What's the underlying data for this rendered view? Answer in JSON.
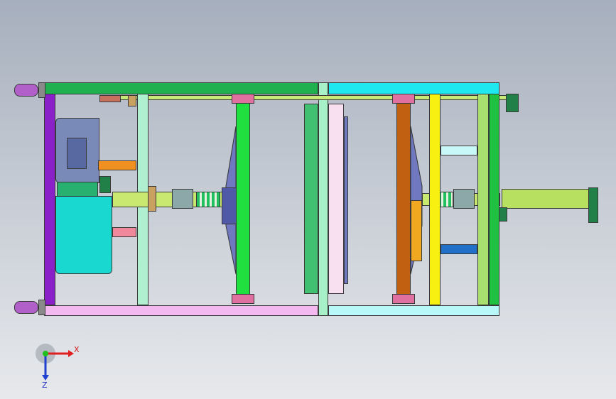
{
  "viewport": {
    "background_top": "#a6afbd",
    "background_bottom": "#e7e9ec"
  },
  "triad": {
    "x_label": "X",
    "z_label": "Z",
    "x_color": "#e02020",
    "y_color": "#20c020",
    "z_color": "#2040d0"
  },
  "parts": {
    "frame_top_rail_left": "#20b050",
    "frame_top_rail_right": "#20e8f0",
    "frame_bottom_rail_left": "#f4b8f0",
    "frame_bottom_rail_right": "#b8f8f8",
    "left_post": "#8a20c8",
    "motor_body": "#7a8ab8",
    "pump_tank": "#18d8d0",
    "mould_left_plate": "#20e040",
    "mould_right_plate": "#c06010",
    "yellow_post": "#f8f010",
    "green_post": "#a8e070",
    "cylinder": "#b8e060"
  }
}
